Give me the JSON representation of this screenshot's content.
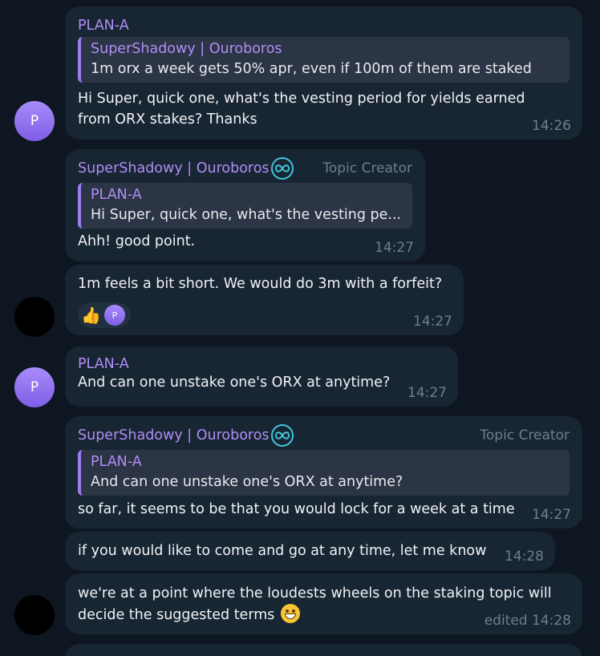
{
  "messages": [
    {
      "sender": "PLAN-A",
      "quote_name": "SuperShadowy | Ouroboros",
      "quote_text": "1m orx a week gets 50% apr, even if 100m of them are staked",
      "body_line1": "Hi Super, quick one, what's the vesting period for yields earned",
      "body_line2": "from ORX stakes? Thanks",
      "time": "14:26",
      "avatar": "P"
    },
    {
      "sender": "SuperShadowy | Ouroboros",
      "role": "Topic Creator",
      "quote_name": "PLAN-A",
      "quote_text": "Hi Super, quick one, what's the vesting pe...",
      "body": "Ahh!  good point.",
      "time": "14:27"
    },
    {
      "body": "1m feels a bit short.  We would do 3m with a forfeit?",
      "reaction_emoji": "👍",
      "reaction_avatar": "P",
      "time": "14:27"
    },
    {
      "sender": "PLAN-A",
      "body": "And can one unstake one's ORX at anytime?",
      "time": "14:27",
      "avatar": "P"
    },
    {
      "sender": "SuperShadowy | Ouroboros",
      "role": "Topic Creator",
      "quote_name": "PLAN-A",
      "quote_text": "And can one unstake one's ORX at anytime?",
      "body": "so far, it seems to be that you would lock for a week at a time",
      "time": "14:27"
    },
    {
      "body": "if you would like to come and go at any time, let me know",
      "time": "14:28"
    },
    {
      "body_line1": "we're at a point where the loudests wheels on the staking topic will",
      "body_line2": "decide the suggested terms",
      "emoji": "smiling-face-icon",
      "time": "edited 14:28"
    }
  ],
  "icons": {
    "ouroboros_badge": "infinity-icon"
  },
  "colors": {
    "background": "#0e1621",
    "bubble": "#182533",
    "sender_name": "#b08ef5",
    "quote_bar": "#9d7cf2",
    "timestamp": "#6d7f8f",
    "badge_ring": "#41c6dc"
  }
}
